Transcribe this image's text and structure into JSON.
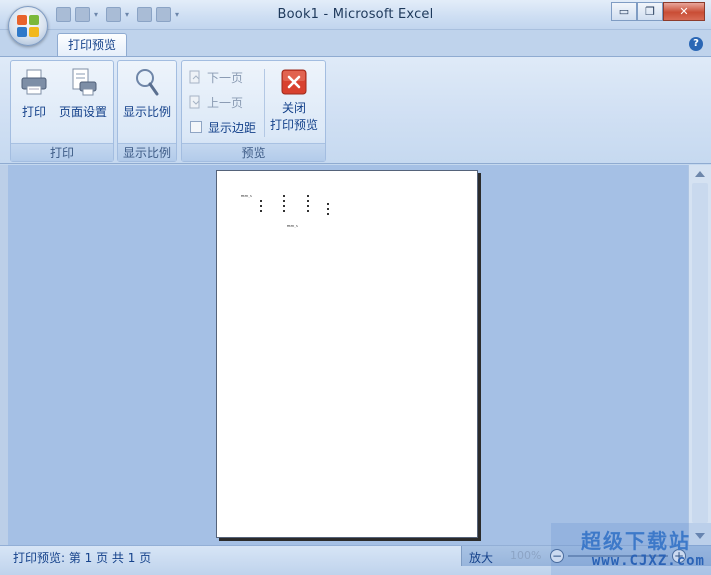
{
  "window": {
    "title": "Book1 - Microsoft Excel",
    "minimize": "▭",
    "restore": "❐",
    "close": "✕"
  },
  "tabs": {
    "active": "打印预览"
  },
  "help": "?",
  "groups": {
    "print": {
      "label": "打印",
      "print_button": "打印",
      "page_setup_button": "页面设置"
    },
    "zoom": {
      "label": "显示比例",
      "zoom_button": "显示比例"
    },
    "preview": {
      "label": "预览",
      "next_page": "下一页",
      "prev_page": "上一页",
      "show_margins": "显示边距",
      "close_line1": "关闭",
      "close_line2": "打印预览"
    }
  },
  "status": {
    "text": "打印预览: 第 1 页 共 1 页",
    "zoom_label": "放大",
    "zoom_percent": "100%",
    "zoom_minus": "−",
    "zoom_plus": "+"
  },
  "watermark": {
    "cn": "超级下载站",
    "en": "www.CJXZ.com"
  },
  "page_preview": {
    "header_text": "MSTK_S",
    "footer_text": "MSTK_S"
  },
  "colors": {
    "ribbon_text": "#15428b",
    "close_icon_bg": "#d8412f",
    "content_bg": "#a5c0e5"
  }
}
